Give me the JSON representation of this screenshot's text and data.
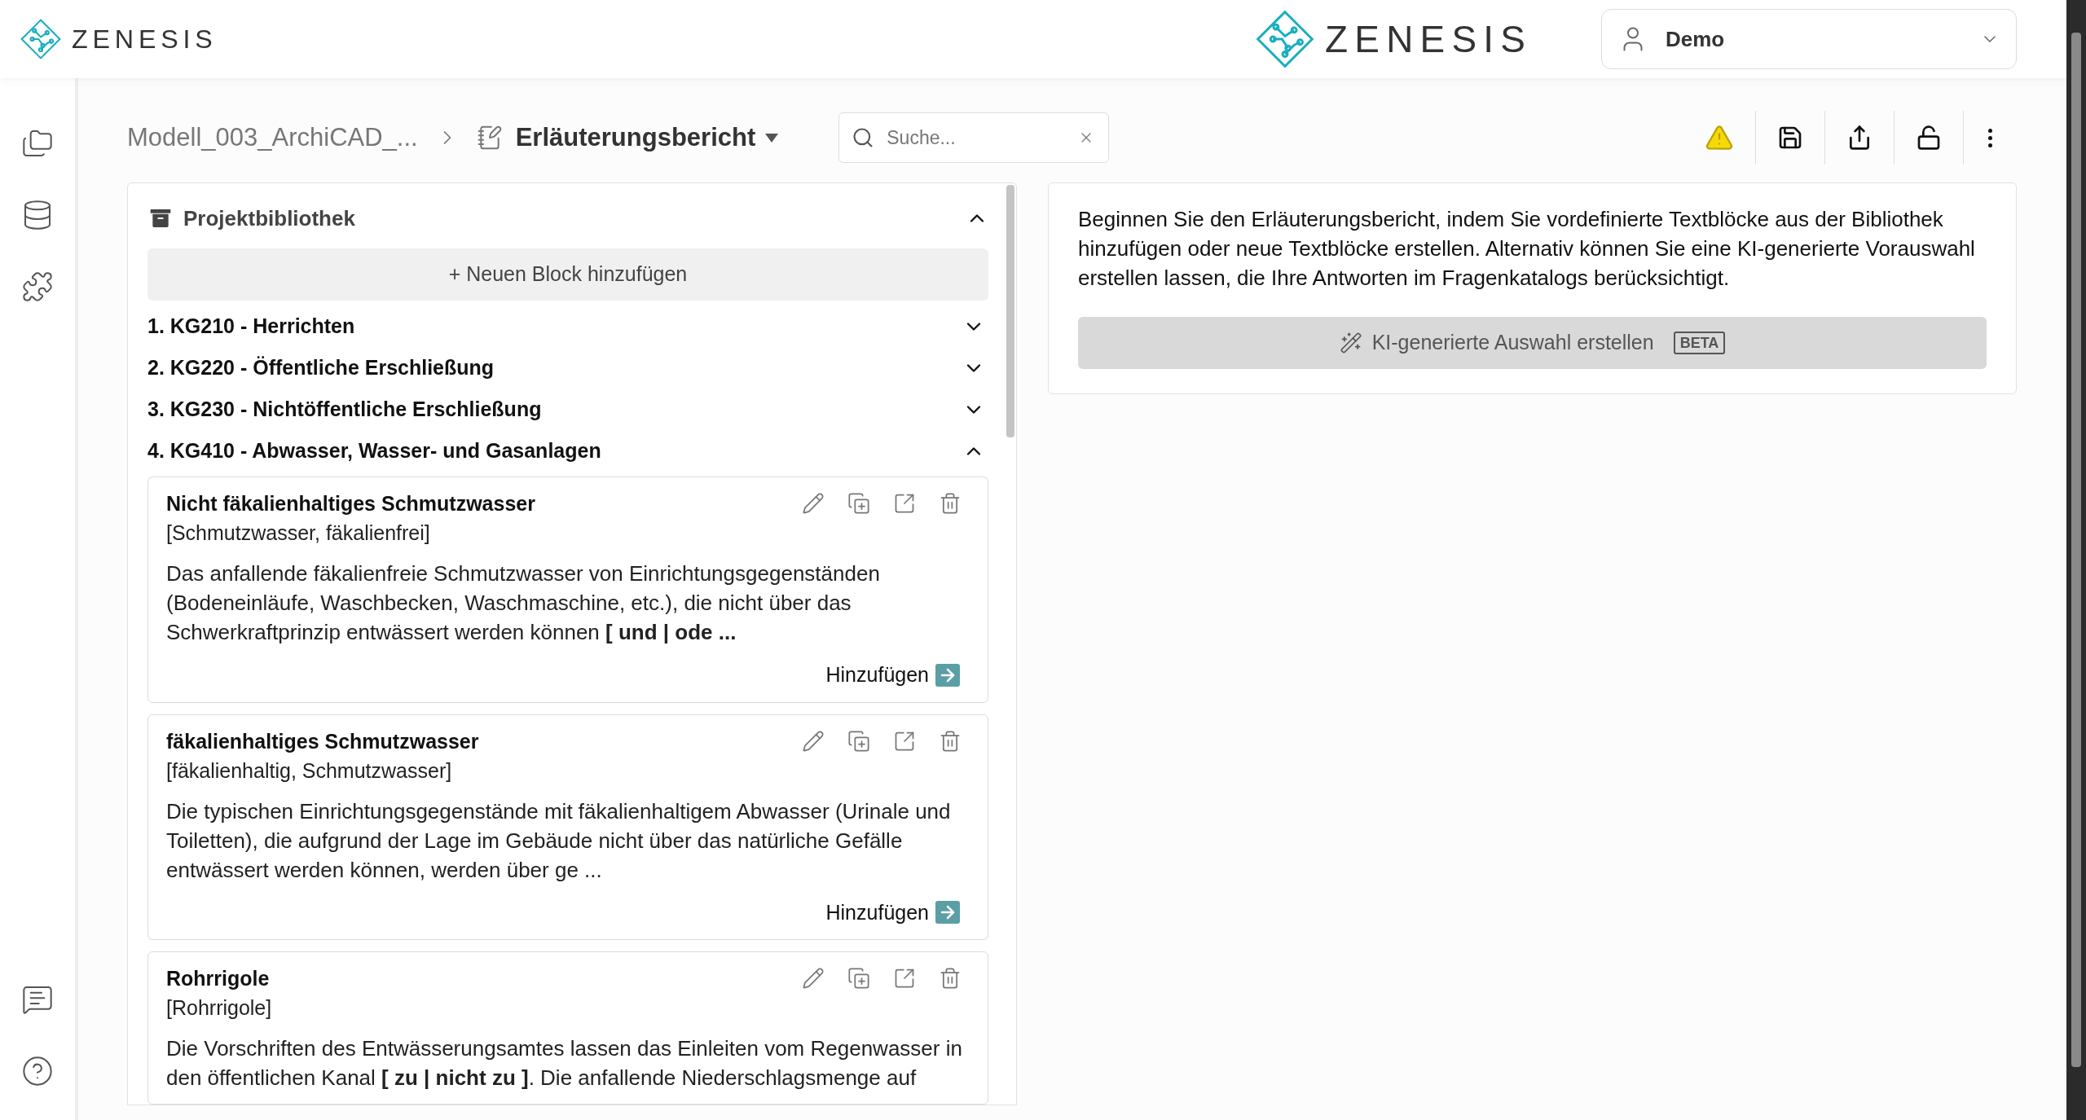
{
  "header": {
    "logo_left": "ZENESIS",
    "logo_center": "ZENESIS",
    "user": {
      "name": "Demo"
    }
  },
  "breadcrumb": {
    "project": "Modell_003_ArchiCAD_...",
    "document": "Erläuterungsbericht"
  },
  "search": {
    "placeholder": "Suche..."
  },
  "toolbar": {
    "warning": true
  },
  "library": {
    "title": "Projektbibliothek",
    "expanded": true,
    "add_button": "+ Neuen Block hinzufügen",
    "groups": [
      {
        "title": "1. KG210 - Herrichten",
        "expanded": false
      },
      {
        "title": "2. KG220 - Öffentliche Erschließung",
        "expanded": false
      },
      {
        "title": "3. KG230 - Nichtöffentliche Erschließung",
        "expanded": false
      },
      {
        "title": "4. KG410 - Abwasser, Wasser- und Gasanlagen",
        "expanded": true,
        "blocks": [
          {
            "title": "Nicht fäkalienhaltiges Schmutzwasser",
            "tags": "[Schmutzwasser, fäkalienfrei]",
            "text": "Das anfallende fäkalienfreie Schmutzwasser von Einrichtungsgegenständen (Bodeneinläufe, Waschbecken, Waschmaschine, etc.), die nicht über das Schwerkraftprinzip entwässert werden können **[ und | ode ...**",
            "add_label": "Hinzufügen"
          },
          {
            "title": "fäkalienhaltiges Schmutzwasser",
            "tags": "[fäkalienhaltig, Schmutzwasser]",
            "text": "Die typischen Einrichtungsgegenstände mit fäkalienhaltigem Abwasser (Urinale und Toiletten), die aufgrund der Lage im Gebäude nicht über das natürliche Gefälle entwässert werden können, werden über ge ...",
            "add_label": "Hinzufügen"
          },
          {
            "title": "Rohrrigole",
            "tags": "[Rohrrigole]",
            "text": "Die Vorschriften des Entwässerungsamtes lassen das Einleiten vom Regenwasser in den öffentlichen Kanal **[ zu | nicht zu ]**. Die anfallende Niederschlagsmenge auf"
          }
        ]
      }
    ]
  },
  "report": {
    "intro": "Beginnen Sie den Erläuterungsbericht, indem Sie vordefinierte Textblöcke aus der Bibliothek hinzufügen oder neue Textblöcke erstellen. Alternativ können Sie eine KI-generierte Vorauswahl erstellen lassen, die Ihre Antworten im Fragenkatalogs berücksichtigt.",
    "ai_button": "KI-generierte Auswahl erstellen",
    "ai_badge": "BETA"
  }
}
